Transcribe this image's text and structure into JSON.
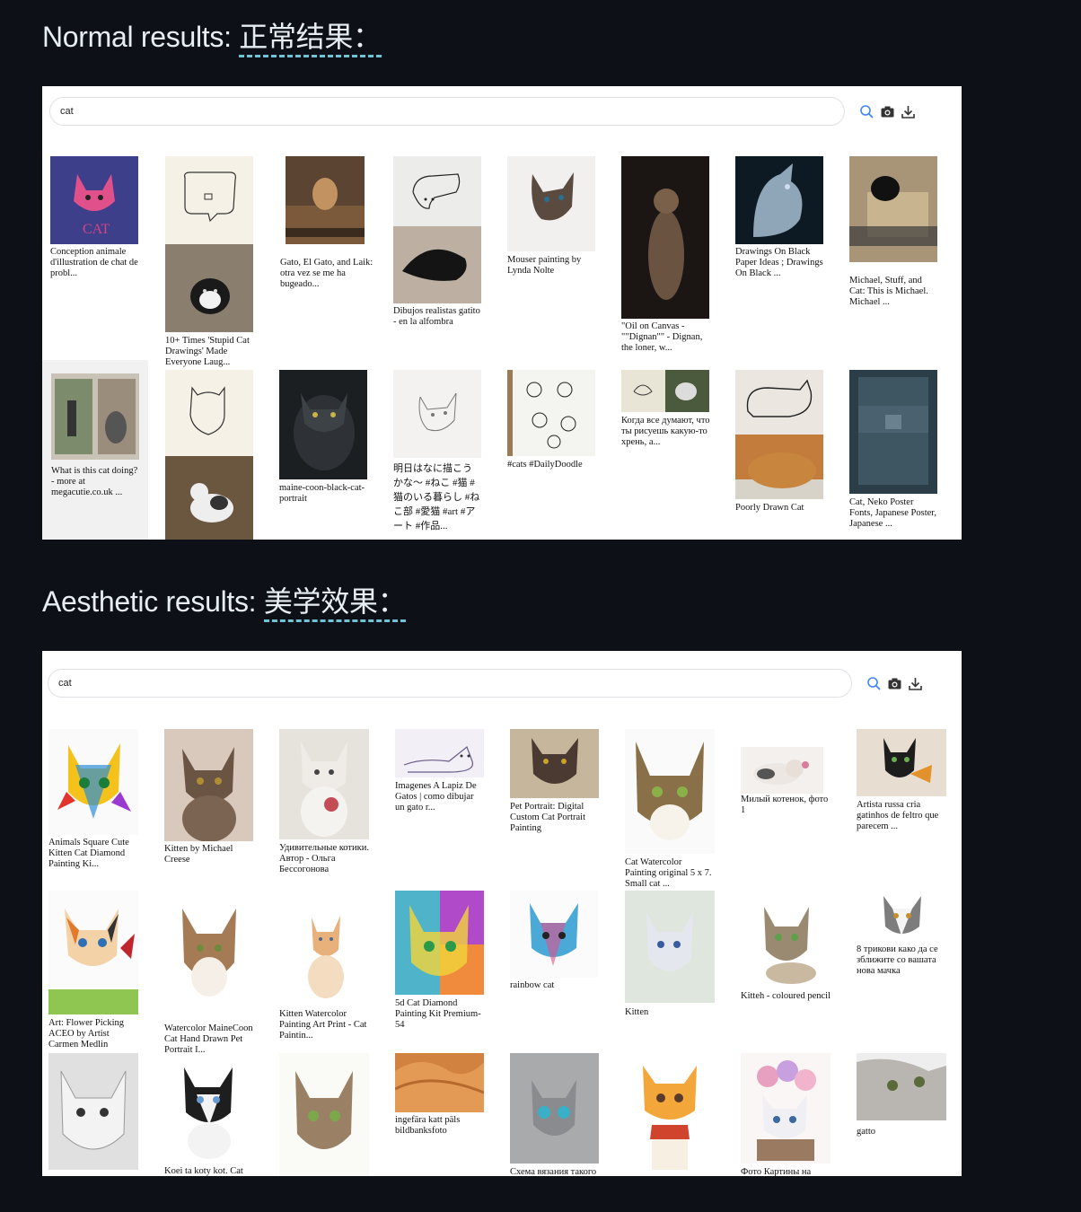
{
  "normal_section": {
    "title_en": "Normal results: ",
    "title_zh": "正常结果：",
    "search_query": "cat",
    "results": [
      {
        "caption": "Conception animale d'illustration de chat de probl..."
      },
      {
        "caption": "10+ Times 'Stupid Cat Drawings' Made Everyone Laug..."
      },
      {
        "caption": "Gato, El Gato, and Laik: otra vez se me ha bugeado..."
      },
      {
        "caption": "Dibujos realistas gatito - en la alfombra"
      },
      {
        "caption": "Mouser painting by Lynda Nolte"
      },
      {
        "caption": "\"Oil on Canvas - \"\"Dignan\"\" - Dignan, the loner, w..."
      },
      {
        "caption": "Drawings On Black Paper Ideas ; Drawings On Black ..."
      },
      {
        "caption": "Michael, Stuff, and Cat: This is Michael. Michael ..."
      },
      {
        "caption": "What is this cat doing? - more at megacutie.co.uk ..."
      },
      {
        "caption": ""
      },
      {
        "caption": "maine-coon-black-cat-portrait"
      },
      {
        "caption": "明日はなに描こうかな〜 #ねこ #猫 #猫のいる暮らし #ねこ部 #愛猫 #art #アート #作品..."
      },
      {
        "caption": "#cats #DailyDoodle"
      },
      {
        "caption": "Когда все думают, что ты рисуешь какую-то хрень, а..."
      },
      {
        "caption": "Poorly Drawn Cat"
      },
      {
        "caption": "Cat, Neko Poster Fonts, Japanese Poster, Japanese ..."
      }
    ]
  },
  "aesthetic_section": {
    "title_en": "Aesthetic results: ",
    "title_zh": "美学效果：",
    "search_query": "cat",
    "results": [
      {
        "caption": "Animals Square Cute Kitten Cat Diamond Painting Ki..."
      },
      {
        "caption": "Kitten by Michael Creese"
      },
      {
        "caption": "Удивительные котики. Автор - Ольга Бессогонова"
      },
      {
        "caption": "Imagenes A Lapiz De Gatos | como dibujar un gato r..."
      },
      {
        "caption": "Pet Portrait: Digital Custom Cat Portrait Painting"
      },
      {
        "caption": "Cat Watercolor Painting original 5 x 7. Small cat ..."
      },
      {
        "caption": "Милый котенок, фото 1"
      },
      {
        "caption": "Artista russa cria gatinhos de feltro que parecem ..."
      },
      {
        "caption": "Art: Flower Picking ACEO by Artist Carmen Medlin"
      },
      {
        "caption": "Watercolor MaineCoon Cat Hand Drawn Pet Portrait I..."
      },
      {
        "caption": "Kitten Watercolor Painting Art Print - Cat Paintin..."
      },
      {
        "caption": "5d Cat Diamond Painting Kit Premium-54"
      },
      {
        "caption": "rainbow cat"
      },
      {
        "caption": "Kitten"
      },
      {
        "caption": "Kitteh - coloured pencil"
      },
      {
        "caption": "8 трикови како да се зближите со вашата нова мачка"
      },
      {
        "caption": ""
      },
      {
        "caption": "Koei ta koty kot. Cat"
      },
      {
        "caption": ""
      },
      {
        "caption": "ingefära katt päls bildbanksfoto"
      },
      {
        "caption": "Схема вязания такого"
      },
      {
        "caption": ""
      },
      {
        "caption": "Фото Картины на"
      },
      {
        "caption": "gatto"
      }
    ]
  },
  "colors": {
    "page_bg": "#0d1117",
    "title_text": "#e6edf3",
    "underline_accent": "#6ec3d4",
    "search_icon": "#4285f4"
  },
  "icons": [
    "search-icon",
    "camera-icon",
    "download-icon"
  ]
}
